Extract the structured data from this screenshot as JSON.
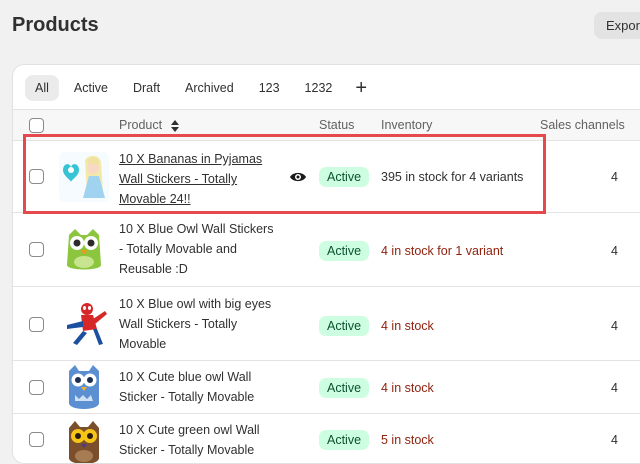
{
  "page": {
    "title": "Products"
  },
  "header_actions": {
    "export_label": "Export"
  },
  "tabs": [
    {
      "label": "All",
      "selected": true
    },
    {
      "label": "Active"
    },
    {
      "label": "Draft"
    },
    {
      "label": "Archived"
    },
    {
      "label": "123"
    },
    {
      "label": "1232"
    }
  ],
  "tab_add_label": "+",
  "columns": {
    "product": "Product",
    "status": "Status",
    "inventory": "Inventory",
    "sales_channels": "Sales channels"
  },
  "rows": [
    {
      "name": "10 X Bananas in Pyjamas Wall Stickers - Totally Movable 24!!",
      "status": "Active",
      "inventory": "395 in stock for 4 variants",
      "channels": "4",
      "thumb_icon": "princess-sticker-icon"
    },
    {
      "name": "10 X Blue Owl Wall Stickers - Totally Movable and Reusable :D",
      "status": "Active",
      "inventory": "4 in stock for 1 variant",
      "channels": "4",
      "thumb_icon": "green-owl-icon"
    },
    {
      "name": "10 X Blue owl with big eyes Wall Stickers - Totally Movable",
      "status": "Active",
      "inventory": "4 in stock",
      "channels": "4",
      "thumb_icon": "spiderman-icon"
    },
    {
      "name": "10 X Cute blue owl Wall Sticker - Totally Movable",
      "status": "Active",
      "inventory": "4 in stock",
      "channels": "4",
      "thumb_icon": "blue-owl-icon"
    },
    {
      "name": "10 X Cute green owl Wall Sticker - Totally Movable",
      "status": "Active",
      "inventory": "5 in stock",
      "channels": "4",
      "thumb_icon": "brown-owl-icon"
    }
  ],
  "colors": {
    "active_badge_bg": "#cdfee1",
    "active_badge_text": "#0c5132",
    "low_stock_text": "#8e1f0b",
    "highlight_border": "#e5484d"
  }
}
